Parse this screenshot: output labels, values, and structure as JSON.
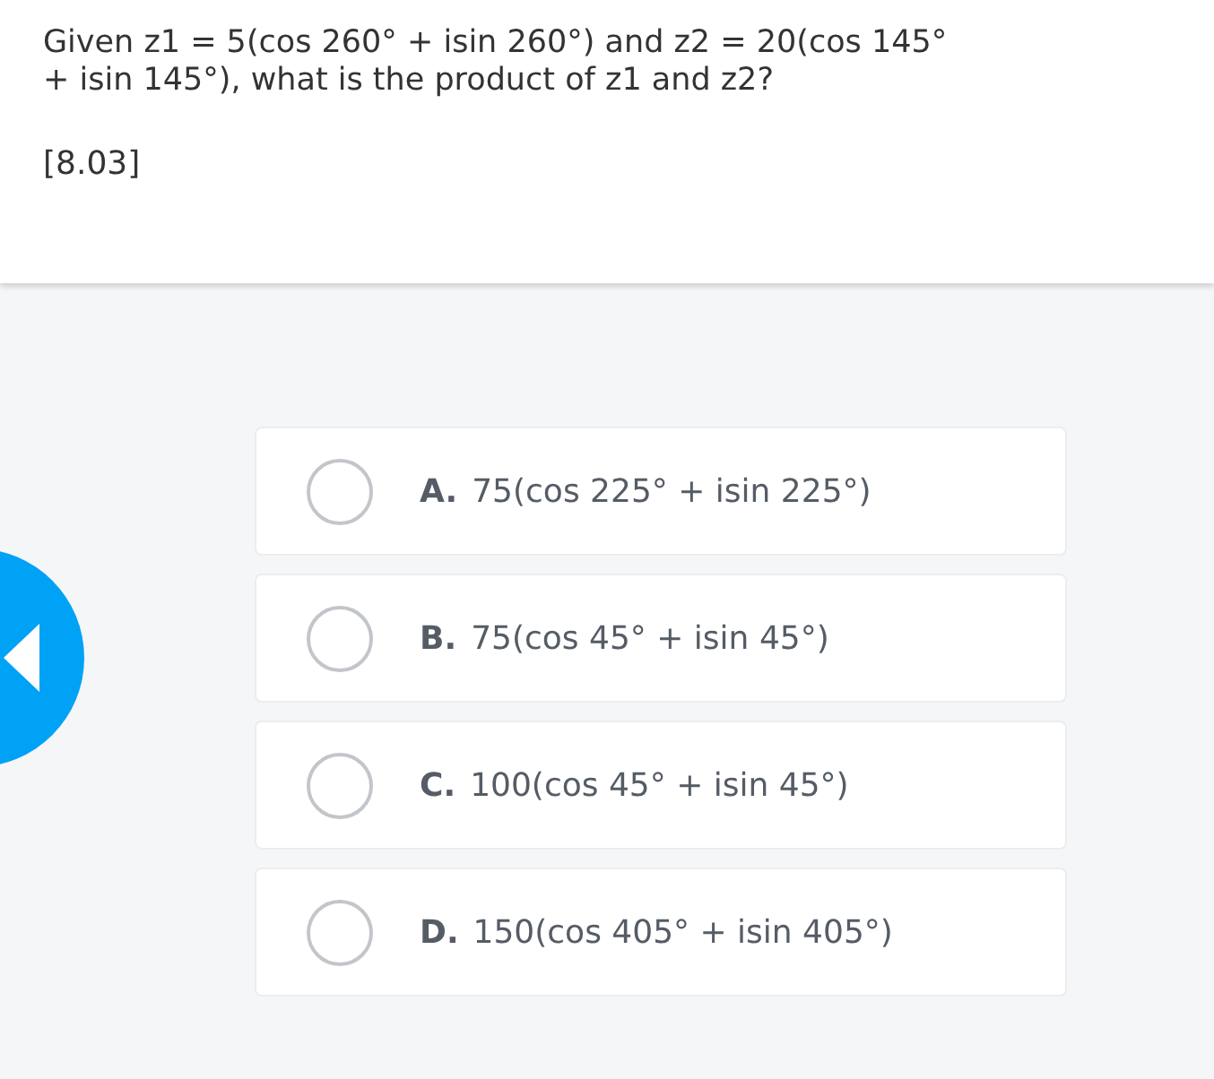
{
  "question": {
    "text": "Given z1 = 5(cos 260° + isin 260°) and z2 = 20(cos 145° + isin 145°), what is the product of z1 and z2?",
    "code": "[8.03]"
  },
  "options": [
    {
      "letter": "A.",
      "text": "75(cos 225° + isin 225°)",
      "selected": false
    },
    {
      "letter": "B.",
      "text": "75(cos 45° + isin 45°)",
      "selected": false
    },
    {
      "letter": "C.",
      "text": "100(cos 45° + isin 45°)",
      "selected": false
    },
    {
      "letter": "D.",
      "text": "150(cos 405° + isin 405°)",
      "selected": false
    }
  ]
}
